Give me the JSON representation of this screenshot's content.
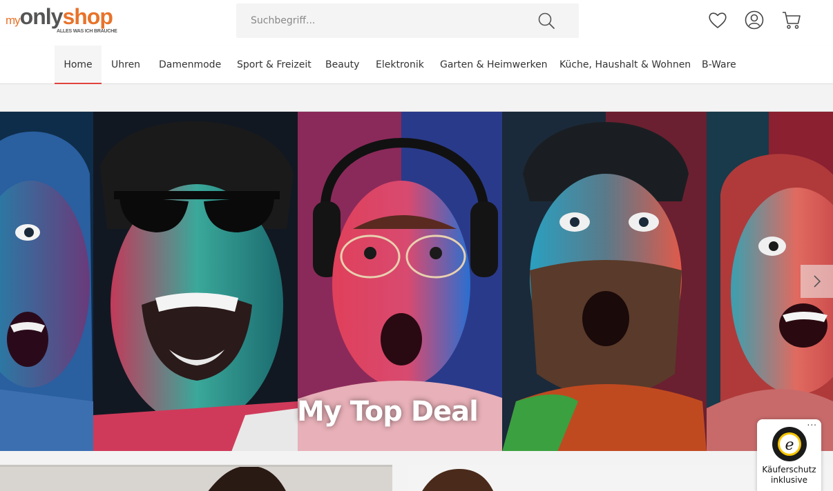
{
  "brand": {
    "prefix": "my",
    "name_part1": "only",
    "name_part2": "shop",
    "tagline": "ALLES WAS ICH BRAUCHE",
    "accent_color": "#e8732a"
  },
  "search": {
    "placeholder": "Suchbegriff..."
  },
  "header_icons": [
    "search-icon",
    "heart-icon",
    "user-icon",
    "cart-icon"
  ],
  "nav": {
    "items": [
      {
        "label": "Home",
        "active": true
      },
      {
        "label": "Uhren"
      },
      {
        "label": "Damenmode"
      },
      {
        "label": "Sport & Freizeit"
      },
      {
        "label": "Beauty"
      },
      {
        "label": "Elektronik"
      },
      {
        "label": "Garten & Heimwerken"
      },
      {
        "label": "Küche, Haushalt & Wohnen"
      },
      {
        "label": "B-Ware"
      }
    ],
    "active_color": "#e1423c"
  },
  "hero": {
    "caption": "My Top Deal"
  },
  "trusted": {
    "menu": "...",
    "line1": "Käuferschutz",
    "line2": "inklusive",
    "seal_text": "TRUSTED SHOPS GUARANTEE"
  }
}
